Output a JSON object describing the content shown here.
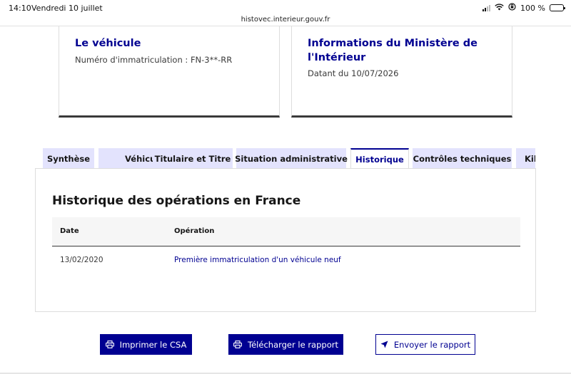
{
  "status_bar": {
    "time": "14:10",
    "date": "Vendredi 10 juillet",
    "battery": "100 %"
  },
  "browser": {
    "url": "histovec.interieur.gouv.fr"
  },
  "cards": {
    "vehicle": {
      "title": "Le véhicule",
      "text": "Numéro d'immatriculation : FN-3**-RR"
    },
    "ministry": {
      "title": "Informations du Ministère de l'Intérieur",
      "text": "Datant du 10/07/2026"
    }
  },
  "tabs": [
    {
      "label": "Synthèse"
    },
    {
      "label": "Véhicule"
    },
    {
      "label": "Titulaire et Titre"
    },
    {
      "label": "Situation administrative"
    },
    {
      "label": "Historique"
    },
    {
      "label": "Contrôles techniques"
    },
    {
      "label": "Kilo"
    }
  ],
  "active_tab": "Historique",
  "history": {
    "title": "Historique des opérations en France",
    "columns": {
      "date": "Date",
      "operation": "Opération"
    },
    "rows": [
      {
        "date": "13/02/2020",
        "operation": "Première immatriculation d'un véhicule neuf"
      }
    ]
  },
  "actions": {
    "print": "Imprimer le CSA",
    "download": "Télécharger le rapport",
    "send": "Envoyer le rapport"
  },
  "colors": {
    "brand_blue": "#000091",
    "tab_bg": "#e3e3fd"
  },
  "icons": {
    "print": "printer-icon",
    "download": "printer-icon",
    "send": "paper-plane-icon"
  }
}
